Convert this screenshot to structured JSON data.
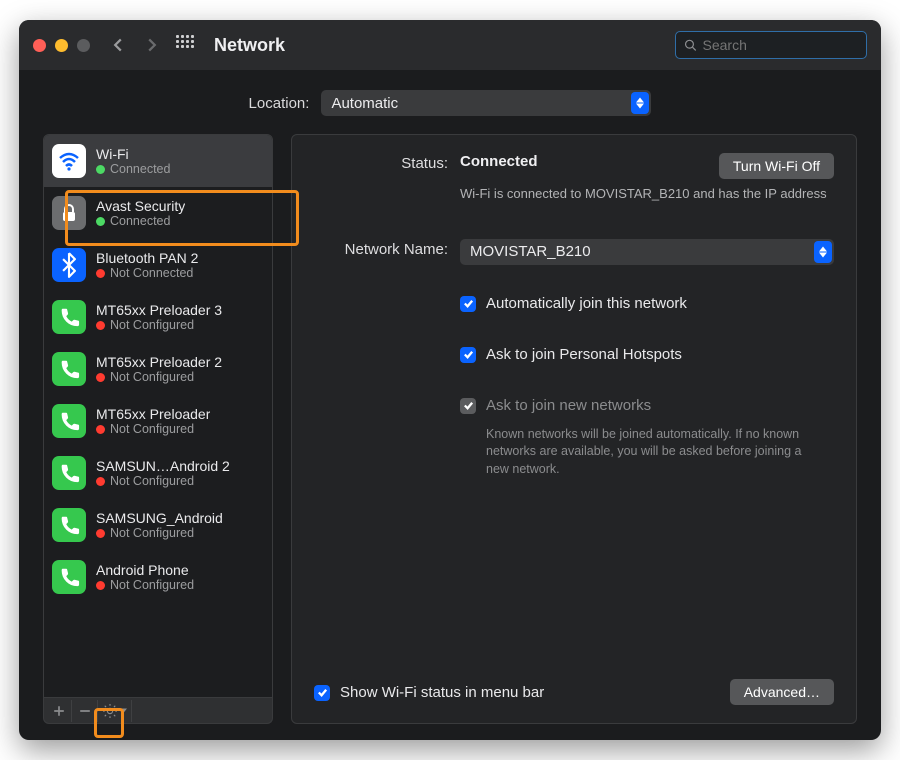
{
  "window": {
    "title": "Network",
    "search_placeholder": "Search"
  },
  "location": {
    "label": "Location:",
    "value": "Automatic"
  },
  "services": [
    {
      "name": "Wi-Fi",
      "status": "Connected",
      "status_color": "green",
      "icon": "wifi",
      "selected": true
    },
    {
      "name": "Avast Security",
      "status": "Connected",
      "status_color": "green",
      "icon": "lock",
      "selected": false
    },
    {
      "name": "Bluetooth PAN 2",
      "status": "Not Connected",
      "status_color": "red",
      "icon": "bt",
      "selected": false
    },
    {
      "name": "MT65xx Preloader 3",
      "status": "Not Configured",
      "status_color": "red",
      "icon": "phone",
      "selected": false
    },
    {
      "name": "MT65xx Preloader 2",
      "status": "Not Configured",
      "status_color": "red",
      "icon": "phone",
      "selected": false
    },
    {
      "name": "MT65xx Preloader",
      "status": "Not Configured",
      "status_color": "red",
      "icon": "phone",
      "selected": false
    },
    {
      "name": "SAMSUN…Android 2",
      "status": "Not Configured",
      "status_color": "red",
      "icon": "phone",
      "selected": false
    },
    {
      "name": "SAMSUNG_Android",
      "status": "Not Configured",
      "status_color": "red",
      "icon": "phone",
      "selected": false
    },
    {
      "name": "Android Phone",
      "status": "Not Configured",
      "status_color": "red",
      "icon": "phone",
      "selected": false
    }
  ],
  "detail": {
    "status_label": "Status:",
    "status_value": "Connected",
    "toggle_button": "Turn Wi-Fi Off",
    "status_desc": "Wi-Fi is connected to MOVISTAR_B210 and has the IP address",
    "network_name_label": "Network Name:",
    "network_name_value": "MOVISTAR_B210",
    "auto_join": "Automatically join this network",
    "ask_hotspots": "Ask to join Personal Hotspots",
    "ask_networks": "Ask to join new networks",
    "ask_networks_hint": "Known networks will be joined automatically. If no known networks are available, you will be asked before joining a new network.",
    "menubar_label": "Show Wi-Fi status in menu bar",
    "advanced_button": "Advanced…"
  }
}
